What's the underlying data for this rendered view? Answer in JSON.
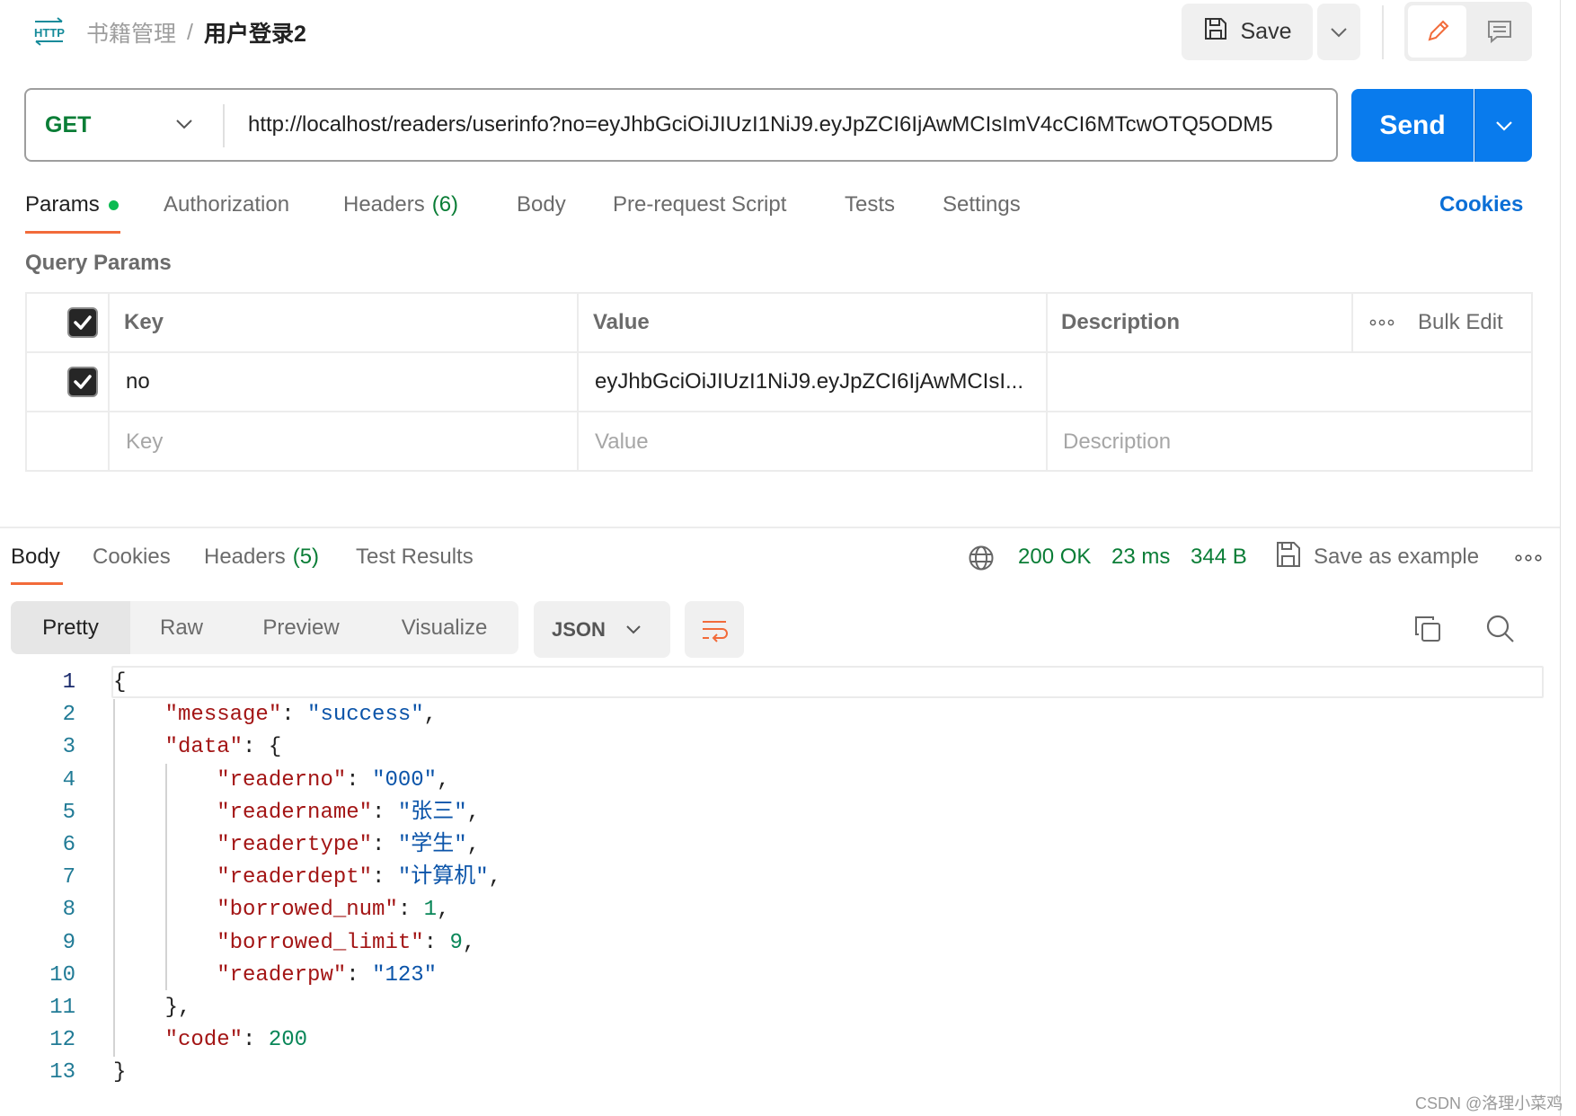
{
  "header": {
    "protocol_icon": "http-icon",
    "breadcrumb_parent": "书籍管理",
    "breadcrumb_separator": "/",
    "breadcrumb_current": "用户登录2",
    "save_label": "Save"
  },
  "request": {
    "method": "GET",
    "url": "http://localhost/readers/userinfo?no=eyJhbGciOiJIUzI1NiJ9.eyJpZCI6IjAwMCIsImV4cCI6MTcwOTQ5ODM5",
    "send_label": "Send"
  },
  "request_tabs": [
    {
      "label": "Params",
      "active": true,
      "has_dot": true
    },
    {
      "label": "Authorization"
    },
    {
      "label": "Headers",
      "count": "(6)"
    },
    {
      "label": "Body"
    },
    {
      "label": "Pre-request Script"
    },
    {
      "label": "Tests"
    },
    {
      "label": "Settings"
    }
  ],
  "cookies_link": "Cookies",
  "query_params": {
    "title": "Query Params",
    "headers": {
      "key": "Key",
      "value": "Value",
      "description": "Description",
      "bulk_edit": "Bulk Edit"
    },
    "rows": [
      {
        "checked": true,
        "key": "no",
        "value": "eyJhbGciOiJIUzI1NiJ9.eyJpZCI6IjAwMCIsI...",
        "description": ""
      }
    ],
    "placeholder": {
      "key": "Key",
      "value": "Value",
      "description": "Description"
    }
  },
  "response_tabs": [
    {
      "label": "Body",
      "active": true
    },
    {
      "label": "Cookies"
    },
    {
      "label": "Headers",
      "count": "(5)"
    },
    {
      "label": "Test Results"
    }
  ],
  "response_meta": {
    "status": "200 OK",
    "time": "23 ms",
    "size": "344 B",
    "save_example": "Save as example",
    "status_color": "#0a7d36"
  },
  "format_tabs": [
    "Pretty",
    "Raw",
    "Preview",
    "Visualize"
  ],
  "format_selected": "Pretty",
  "language": "JSON",
  "code_lines": [
    {
      "n": "1",
      "indent": "",
      "parts": [
        {
          "t": "p",
          "v": "{"
        }
      ]
    },
    {
      "n": "2",
      "indent": "    ",
      "parts": [
        {
          "t": "k",
          "v": "\"message\""
        },
        {
          "t": "p",
          "v": ": "
        },
        {
          "t": "s",
          "v": "\"success\""
        },
        {
          "t": "p",
          "v": ","
        }
      ]
    },
    {
      "n": "3",
      "indent": "    ",
      "parts": [
        {
          "t": "k",
          "v": "\"data\""
        },
        {
          "t": "p",
          "v": ": {"
        }
      ]
    },
    {
      "n": "4",
      "indent": "        ",
      "parts": [
        {
          "t": "k",
          "v": "\"readerno\""
        },
        {
          "t": "p",
          "v": ": "
        },
        {
          "t": "s",
          "v": "\"000\""
        },
        {
          "t": "p",
          "v": ","
        }
      ]
    },
    {
      "n": "5",
      "indent": "        ",
      "parts": [
        {
          "t": "k",
          "v": "\"readername\""
        },
        {
          "t": "p",
          "v": ": "
        },
        {
          "t": "s",
          "v": "\"张三\""
        },
        {
          "t": "p",
          "v": ","
        }
      ]
    },
    {
      "n": "6",
      "indent": "        ",
      "parts": [
        {
          "t": "k",
          "v": "\"readertype\""
        },
        {
          "t": "p",
          "v": ": "
        },
        {
          "t": "s",
          "v": "\"学生\""
        },
        {
          "t": "p",
          "v": ","
        }
      ]
    },
    {
      "n": "7",
      "indent": "        ",
      "parts": [
        {
          "t": "k",
          "v": "\"readerdept\""
        },
        {
          "t": "p",
          "v": ": "
        },
        {
          "t": "s",
          "v": "\"计算机\""
        },
        {
          "t": "p",
          "v": ","
        }
      ]
    },
    {
      "n": "8",
      "indent": "        ",
      "parts": [
        {
          "t": "k",
          "v": "\"borrowed_num\""
        },
        {
          "t": "p",
          "v": ": "
        },
        {
          "t": "n",
          "v": "1"
        },
        {
          "t": "p",
          "v": ","
        }
      ]
    },
    {
      "n": "9",
      "indent": "        ",
      "parts": [
        {
          "t": "k",
          "v": "\"borrowed_limit\""
        },
        {
          "t": "p",
          "v": ": "
        },
        {
          "t": "n",
          "v": "9"
        },
        {
          "t": "p",
          "v": ","
        }
      ]
    },
    {
      "n": "10",
      "indent": "        ",
      "parts": [
        {
          "t": "k",
          "v": "\"readerpw\""
        },
        {
          "t": "p",
          "v": ": "
        },
        {
          "t": "s",
          "v": "\"123\""
        }
      ]
    },
    {
      "n": "11",
      "indent": "    ",
      "parts": [
        {
          "t": "p",
          "v": "},"
        }
      ]
    },
    {
      "n": "12",
      "indent": "    ",
      "parts": [
        {
          "t": "k",
          "v": "\"code\""
        },
        {
          "t": "p",
          "v": ": "
        },
        {
          "t": "n",
          "v": "200"
        }
      ]
    },
    {
      "n": "13",
      "indent": "",
      "parts": [
        {
          "t": "p",
          "v": "}"
        }
      ]
    }
  ],
  "watermark": "CSDN @洛理小菜鸡"
}
